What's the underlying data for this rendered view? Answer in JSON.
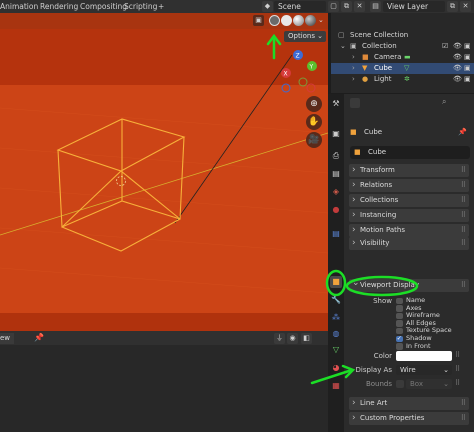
{
  "topbar": {
    "menus": [
      "Animation",
      "Rendering",
      "Compositing",
      "Scripting",
      "+"
    ],
    "scene": "Scene",
    "view_layer": "View Layer"
  },
  "viewport": {
    "options_label": "Options",
    "gizmo_axes": [
      "Z",
      "Y",
      "X"
    ]
  },
  "lower_editor": {
    "view_label": "ew"
  },
  "outliner": {
    "rows": [
      {
        "label": "Scene Collection"
      },
      {
        "label": "Collection"
      },
      {
        "label": "Camera"
      },
      {
        "label": "Cube"
      },
      {
        "label": "Light"
      }
    ]
  },
  "properties": {
    "object_name_header": "Cube",
    "object_name_field": "Cube",
    "panels": [
      "Transform",
      "Relations",
      "Collections",
      "Instancing",
      "Motion Paths",
      "Visibility",
      "Viewport Display"
    ],
    "show_label": "Show",
    "show_options": [
      {
        "label": "Name",
        "checked": false
      },
      {
        "label": "Axes",
        "checked": false
      },
      {
        "label": "Wireframe",
        "checked": false
      },
      {
        "label": "All Edges",
        "checked": false
      },
      {
        "label": "Texture Space",
        "checked": false
      },
      {
        "label": "Shadow",
        "checked": true
      },
      {
        "label": "In Front",
        "checked": false
      }
    ],
    "color_label": "Color",
    "display_as_label": "Display As",
    "display_as_value": "Wire",
    "bounds_label": "Bounds",
    "bounds_value": "Box",
    "bottom_panels": [
      "Line Art",
      "Custom Properties"
    ]
  },
  "colors": {
    "viewport_bg": "#c2390e",
    "selection": "#324b74",
    "annotation": "#1cde26",
    "wire": "#f7b03a"
  }
}
